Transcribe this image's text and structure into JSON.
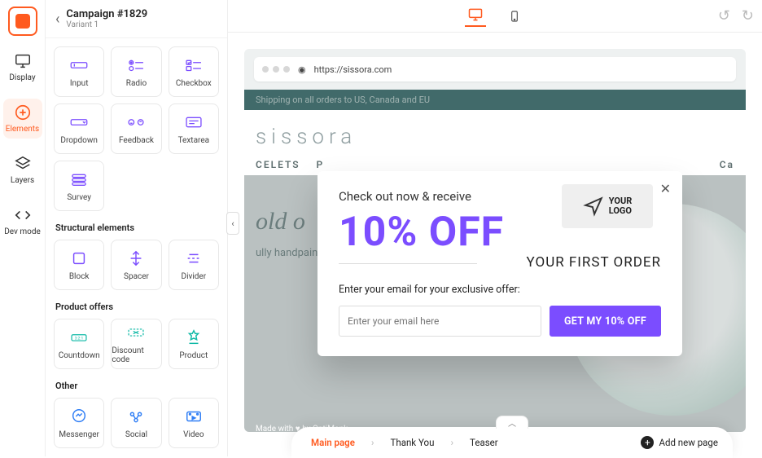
{
  "header": {
    "campaign_title": "Campaign #1829",
    "variant_label": "Variant 1"
  },
  "rail": {
    "display": "Display",
    "elements": "Elements",
    "layers": "Layers",
    "devmode": "Dev mode"
  },
  "elements": {
    "basic": [
      {
        "label": "Input"
      },
      {
        "label": "Radio"
      },
      {
        "label": "Checkbox"
      },
      {
        "label": "Dropdown"
      },
      {
        "label": "Feedback"
      },
      {
        "label": "Textarea"
      },
      {
        "label": "Survey"
      }
    ],
    "structural_label": "Structural elements",
    "structural": [
      {
        "label": "Block"
      },
      {
        "label": "Spacer"
      },
      {
        "label": "Divider"
      }
    ],
    "offers_label": "Product offers",
    "offers": [
      {
        "label": "Countdown"
      },
      {
        "label": "Discount code"
      },
      {
        "label": "Product"
      }
    ],
    "other_label": "Other",
    "other": [
      {
        "label": "Messenger"
      },
      {
        "label": "Social"
      },
      {
        "label": "Video"
      }
    ]
  },
  "preview": {
    "url": "https://sissora.com",
    "banner": "Shipping on all orders to US, Canada and EU",
    "brand": "sissora",
    "nav1": "CELETS",
    "nav2": "P",
    "nav_right": "Ca",
    "hero_title": "old o",
    "hero_sub": "ully handpainted by dedicated",
    "made_with": "Made with ♥ by OptiMonk"
  },
  "popup": {
    "line1": "Check out now & receive",
    "big": "10% OFF",
    "line2": "YOUR FIRST ORDER",
    "sub": "Enter your email for your exclusive offer:",
    "placeholder": "Enter your email here",
    "cta": "GET MY 10% OFF",
    "logo_text": "YOUR\nLOGO"
  },
  "page_tabs": {
    "items": [
      "Main page",
      "Thank You",
      "Teaser"
    ],
    "add": "Add new page"
  }
}
